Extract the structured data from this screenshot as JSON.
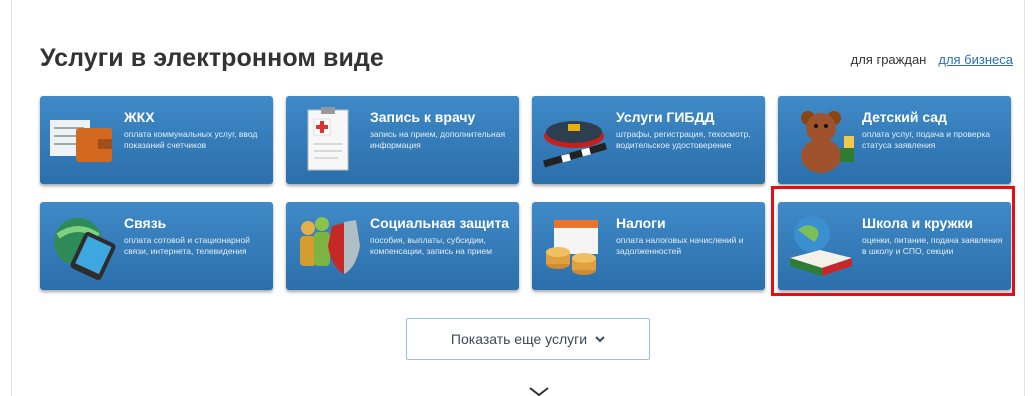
{
  "section": {
    "title": "Услуги в электронном виде",
    "filter": {
      "citizens": "для граждан",
      "business": "для бизнеса"
    }
  },
  "tiles": [
    {
      "title": "ЖКХ",
      "desc": "оплата коммунальных услуг, ввод показаний счетчиков",
      "icon": "utility-bill-wallet-icon"
    },
    {
      "title": "Запись к врачу",
      "desc": "запись на прием, дополнительная информация",
      "icon": "medical-clipboard-icon"
    },
    {
      "title": "Услуги ГИБДД",
      "desc": "штрафы, регистрация, техосмотр, водительское удостоверение",
      "icon": "police-cap-baton-icon"
    },
    {
      "title": "Детский сад",
      "desc": "оплата услуг, подача и проверка статуса заявления",
      "icon": "teddy-bear-icon"
    },
    {
      "title": "Связь",
      "desc": "оплата сотовой и стационарной связи, интернета, телевидения",
      "icon": "globe-phone-icon"
    },
    {
      "title": "Социальная защита",
      "desc": "пособия, выплаты, субсидии, компенсации, запись на прием",
      "icon": "people-shield-icon"
    },
    {
      "title": "Налоги",
      "desc": "оплата налоговых начислений и задолженностей",
      "icon": "calendar-coins-icon"
    },
    {
      "title": "Школа и кружки",
      "desc": "оценки, питание, подача заявления в школу и СПО, секции",
      "icon": "globe-book-icon"
    }
  ],
  "more_button": {
    "label": "Показать еще услуги",
    "icon": "chevron-down-icon"
  },
  "colors": {
    "tile": "#2f78b8",
    "link": "#2a6fb5",
    "highlight": "#e50e15"
  }
}
